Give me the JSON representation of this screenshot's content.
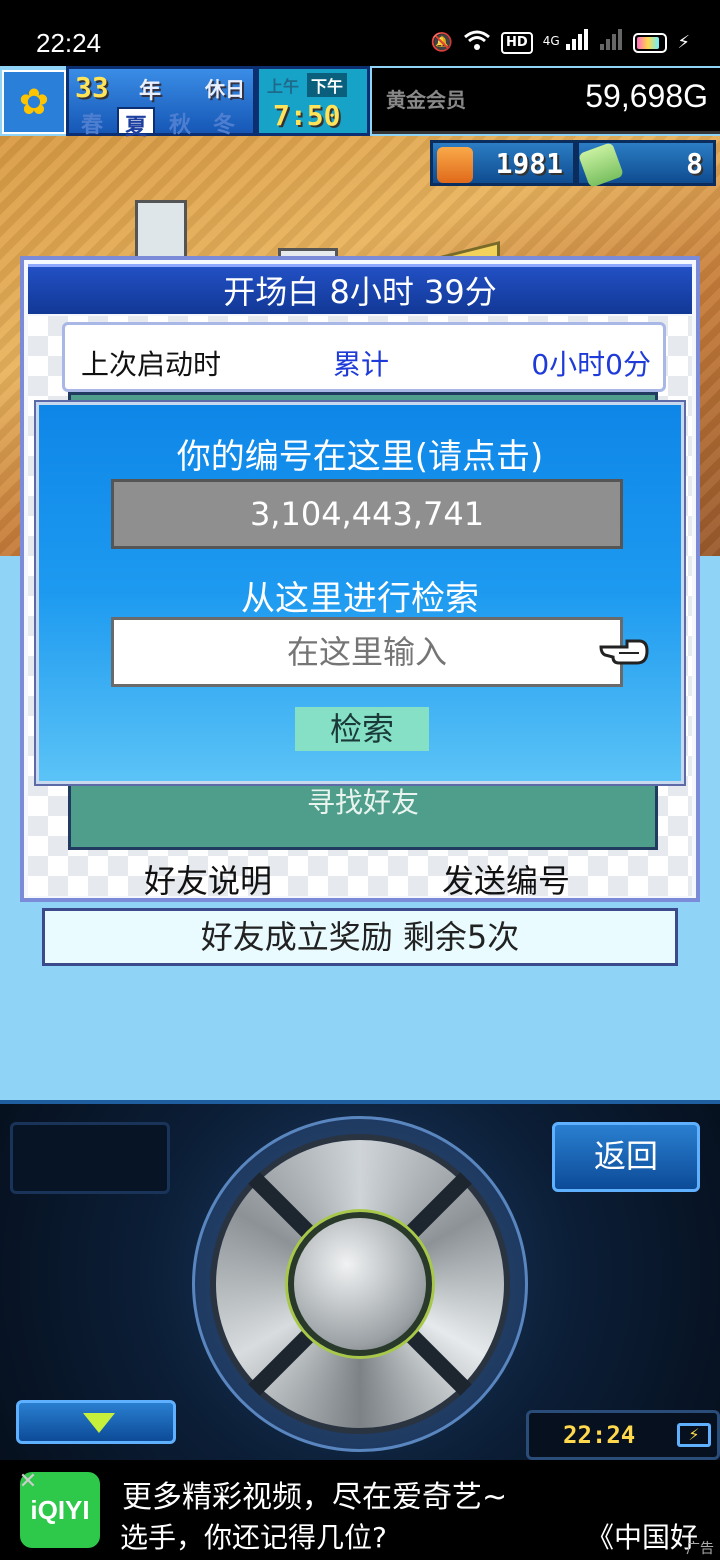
{
  "status_bar": {
    "time": "22:24",
    "icons": [
      "mute-icon",
      "wifi-icon",
      "hd-icon",
      "signal-4g-icon",
      "signal-icon",
      "battery-icon",
      "charging-icon"
    ],
    "hd_label": "HD",
    "net_label": "4G"
  },
  "hud": {
    "year_num": "33",
    "year_label": "年",
    "holiday_label": "休日",
    "seasons": [
      "春",
      "夏",
      "秋",
      "冬"
    ],
    "active_season_index": 1,
    "am_label": "上午",
    "pm_label": "下午",
    "clock": "7:50",
    "rank_label": "黄金会员",
    "gold": "59,698G",
    "research_points": "1981",
    "tickets": "8"
  },
  "panel": {
    "title": "开场白  8小时 39分",
    "last_launch_label": "上次启动时",
    "cumulative_label": "累计",
    "cumulative_value": "0小时0分",
    "find_friend_label": "寻找好友",
    "friend_desc_button": "好友说明",
    "send_id_button": "发送编号"
  },
  "reward": {
    "text": "好友成立奖励  剩余5次"
  },
  "dialog": {
    "heading": "你的编号在这里(请点击)",
    "player_id": "3,104,443,741",
    "search_label": "从这里进行检索",
    "input_placeholder": "在这里输入",
    "input_value": "",
    "search_button": "检索"
  },
  "controller": {
    "back_button": "返回",
    "clock": "22:24"
  },
  "ad": {
    "logo_text": "iQIYI",
    "title": "更多精彩视频，尽在爱奇艺~",
    "subtitle": "选手，你还记得几位?",
    "subtitle2": "《中国好",
    "tag": "广告"
  },
  "colors": {
    "dialog_bg": "#1d9af0",
    "panel_title_bg": "#2250c4",
    "search_button_bg": "#86e0c5",
    "id_box_bg": "#8f8f8f",
    "accent_blue": "#1e3ad8"
  }
}
